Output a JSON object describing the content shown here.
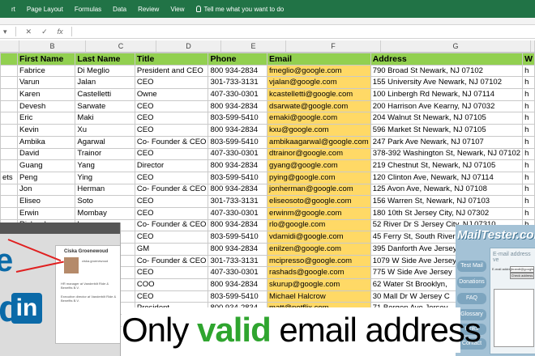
{
  "ribbon": {
    "tabs": [
      "rt",
      "Page Layout",
      "Formulas",
      "Data",
      "Review",
      "View"
    ],
    "tell_me": "Tell me what you want to do"
  },
  "formula_bar": {
    "cancel": "✕",
    "enter": "✓",
    "fx": "fx"
  },
  "columns": [
    "B",
    "C",
    "D",
    "E",
    "F",
    "G"
  ],
  "headers": [
    "",
    "First Name",
    "Last Name",
    "Title",
    "Phone",
    "Email",
    "Address",
    "W"
  ],
  "rows": [
    [
      "",
      "Fabrice",
      "Di Meglio",
      "President and CEO",
      "800 934-2834",
      "fmeglio@google.com",
      "790 Broad St Newark, NJ 07102",
      "h"
    ],
    [
      "",
      "Varun",
      "Jalan",
      "CEO",
      "301-733-3131",
      "vjalan@google.com",
      "155 University Ave Newark, NJ 07102",
      "h"
    ],
    [
      "",
      "Karen",
      "Castelletti",
      "Owne",
      "407-330-0301",
      "kcastelletti@google.com",
      "100 Linbergh Rd Newark, NJ 07114",
      "h"
    ],
    [
      "",
      "Devesh",
      "Sarwate",
      "CEO",
      "800 934-2834",
      "dsarwate@google.com",
      "200 Harrison Ave Kearny, NJ 07032",
      "h"
    ],
    [
      "",
      "Eric",
      "Maki",
      "CEO",
      "803-599-5410",
      "emaki@google.com",
      "204 Walnut St Newark, NJ 07105",
      "h"
    ],
    [
      "",
      "Kevin",
      "Xu",
      "CEO",
      "800 934-2834",
      "kxu@google.com",
      "596 Market St Newark, NJ 07105",
      "h"
    ],
    [
      "",
      "Ambika",
      "Agarwal",
      "Co- Founder & CEO",
      "803-599-5410",
      "ambikaagarwal@google.com",
      "247 Park Ave Newark, NJ 07107",
      "h"
    ],
    [
      "",
      "David",
      "Trainor",
      "CEO",
      "407-330-0301",
      "dtrainor@google.com",
      "378-392 Washington St, Newark, NJ 07102",
      "h"
    ],
    [
      "",
      "Guang",
      "Yang",
      "Director",
      "800 934-2834",
      "gyang@google.com",
      "219 Chestnut St, Newark, NJ 07105",
      "h"
    ],
    [
      "ets",
      "Peng",
      "Ying",
      "CEO",
      "803-599-5410",
      "pying@google.com",
      "120 Clinton Ave, Newark, NJ 07114",
      "h"
    ],
    [
      "",
      "Jon",
      "Herman",
      "Co- Founder & CEO",
      "800 934-2834",
      "jonherman@google.com",
      "125 Avon Ave, Newark, NJ 07108",
      "h"
    ],
    [
      "",
      "Eliseo",
      "Soto",
      "CEO",
      "301-733-3131",
      "eliseosoto@google.com",
      "156 Warren St, Newark, NJ 07103",
      "h"
    ],
    [
      "",
      "Erwin",
      "Mombay",
      "CEO",
      "407-330-0301",
      "erwinm@google.com",
      "180 10th St Jersey City, NJ 07302",
      "h"
    ],
    [
      "",
      "Richard",
      "Lo",
      "Co- Founder & CEO",
      "800 934-2834",
      "rlo@google.com",
      "52 River Dr S Jersey City, NJ 07310",
      "h"
    ],
    [
      "",
      "",
      "",
      "CEO",
      "803-599-5410",
      "vdamidi@google.com",
      "45 Ferry St, South River",
      "h"
    ],
    [
      "",
      "",
      "",
      "GM",
      "800 934-2834",
      "enilzen@google.com",
      "395 Danforth Ave Jersey",
      "h"
    ],
    [
      "",
      "",
      "",
      "Co- Founder & CEO",
      "301-733-3131",
      "mcipresso@google.com",
      "1079 W Side Ave Jersey",
      "h"
    ],
    [
      "",
      "",
      "",
      "CEO",
      "407-330-0301",
      "rashads@google.com",
      "775 W Side Ave Jersey",
      "h"
    ],
    [
      "",
      "",
      "",
      "COO",
      "800 934-2834",
      "skurup@google.com",
      "62 Water St Brooklyn,",
      "h"
    ],
    [
      "",
      "",
      "",
      "CEO",
      "803-599-5410",
      "Michael Halcrow",
      "30 Mall Dr W Jersey C",
      "h"
    ],
    [
      "",
      "",
      "ek",
      "President",
      "800 934-2834",
      "matt@netflix.com",
      "71 Bergen Ave Jersey",
      "h"
    ],
    [
      "",
      "",
      "",
      "Director",
      "301-733-3131",
      "blam@netflix.com",
      "56 Sip Ave Jersey City,",
      "h"
    ]
  ],
  "caption": {
    "pre": "Only ",
    "valid": "valid",
    "post": " email address"
  },
  "linkedin_panel": {
    "name": "Ciska Groenewoud",
    "logo_word": "e",
    "logo_in": "in",
    "logo_d": "d",
    "lines": [
      "ciska.groenewoud",
      "HR manager at Vanderbilt Ride & Benefits B.V.",
      "Executive director at Vanderbilt Ride & Benefits B.V."
    ]
  },
  "mailtester_panel": {
    "logo": "MailTester.com",
    "menu": [
      "Test Mail",
      "Donations",
      "FAQ",
      "Glossary",
      "Links",
      "Contact"
    ],
    "title": "E-mail address ve",
    "label": "E-mail address",
    "input_value": "jbrandt@google.",
    "button": "Check address"
  },
  "colors": {
    "ribbon": "#217346",
    "header_fill": "#92d050",
    "email_fill": "#ffd966"
  }
}
